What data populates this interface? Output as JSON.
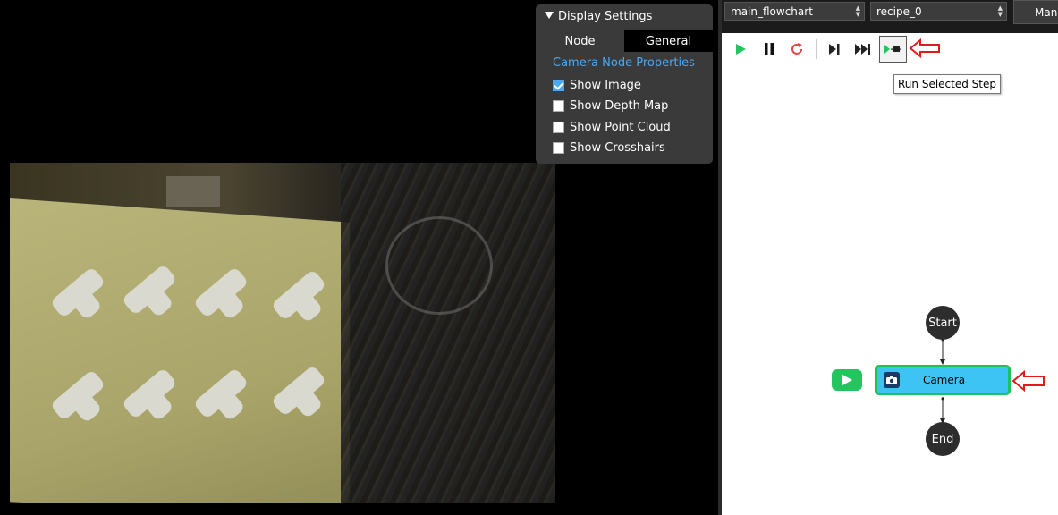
{
  "display_settings": {
    "header": "Display Settings",
    "tabs": [
      {
        "label": "Node",
        "active": false
      },
      {
        "label": "General",
        "active": true
      }
    ],
    "section_title": "Camera Node Properties",
    "options": [
      {
        "label": "Show Image",
        "checked": true
      },
      {
        "label": "Show Depth Map",
        "checked": false
      },
      {
        "label": "Show Point Cloud",
        "checked": false
      },
      {
        "label": "Show Crosshairs",
        "checked": false
      }
    ]
  },
  "topbar": {
    "flowchart_select": "main_flowchart",
    "recipe_select": "recipe_0",
    "man_button": "Man"
  },
  "toolbar": {
    "tooltip": "Run Selected Step",
    "icons": [
      "play-icon",
      "pause-icon",
      "restart-icon",
      "step-icon",
      "fast-forward-icon",
      "run-selected-step-icon"
    ]
  },
  "flowchart": {
    "start_label": "Start",
    "camera_label": "Camera",
    "end_label": "End"
  },
  "colors": {
    "accent": "#4aa8f5",
    "node_fill": "#3ec3f5",
    "node_border": "#1fc254",
    "play_green": "#22c55e",
    "annotation_red": "#e01b1b"
  }
}
